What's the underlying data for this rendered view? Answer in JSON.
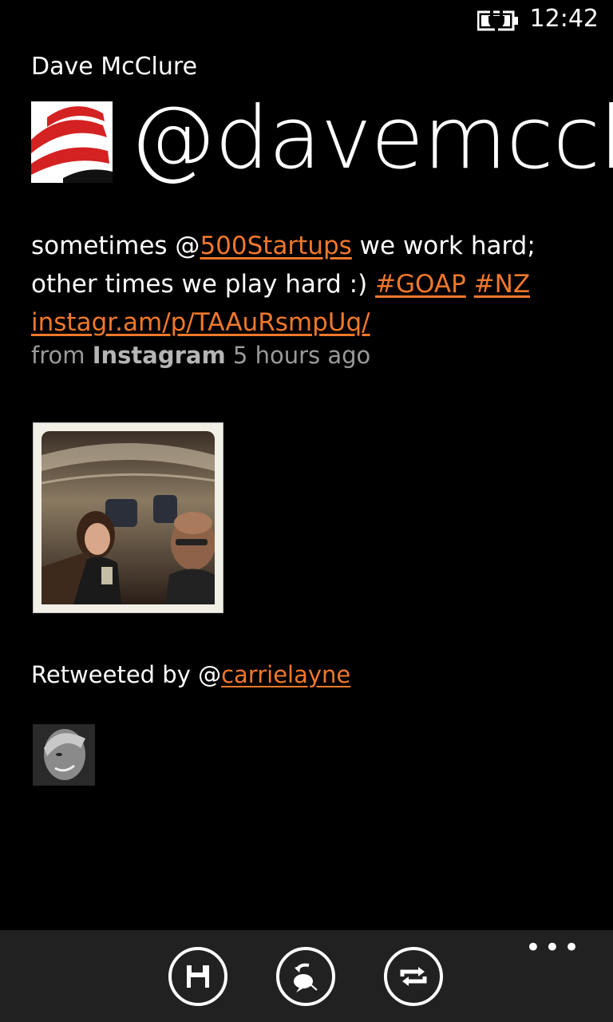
{
  "status_bar": {
    "time": "12:42",
    "battery_icon": "battery-charging-icon"
  },
  "profile": {
    "display_name": "Dave McClure",
    "handle": "@davemcclure"
  },
  "tweet": {
    "segments": {
      "t1": "sometimes @",
      "mention": "500Startups",
      "t2": " we work hard; other times we play hard :) ",
      "tag1": "#GOAP",
      "sp": " ",
      "tag2": "#NZ",
      "url": "instagr.am/p/TAAuRsmpUq/"
    },
    "meta": {
      "from": "from",
      "source": "Instagram",
      "time_ago": "5 hours ago"
    }
  },
  "retweet": {
    "prefix": "Retweeted by @",
    "user": "carrielayne"
  },
  "app_bar": {
    "buttons": [
      {
        "icon": "save-icon"
      },
      {
        "icon": "reply-icon"
      },
      {
        "icon": "retweet-icon"
      }
    ],
    "more": "•••"
  },
  "colors": {
    "accent": "#f0782a",
    "background": "#000000",
    "app_bar": "#212121"
  }
}
